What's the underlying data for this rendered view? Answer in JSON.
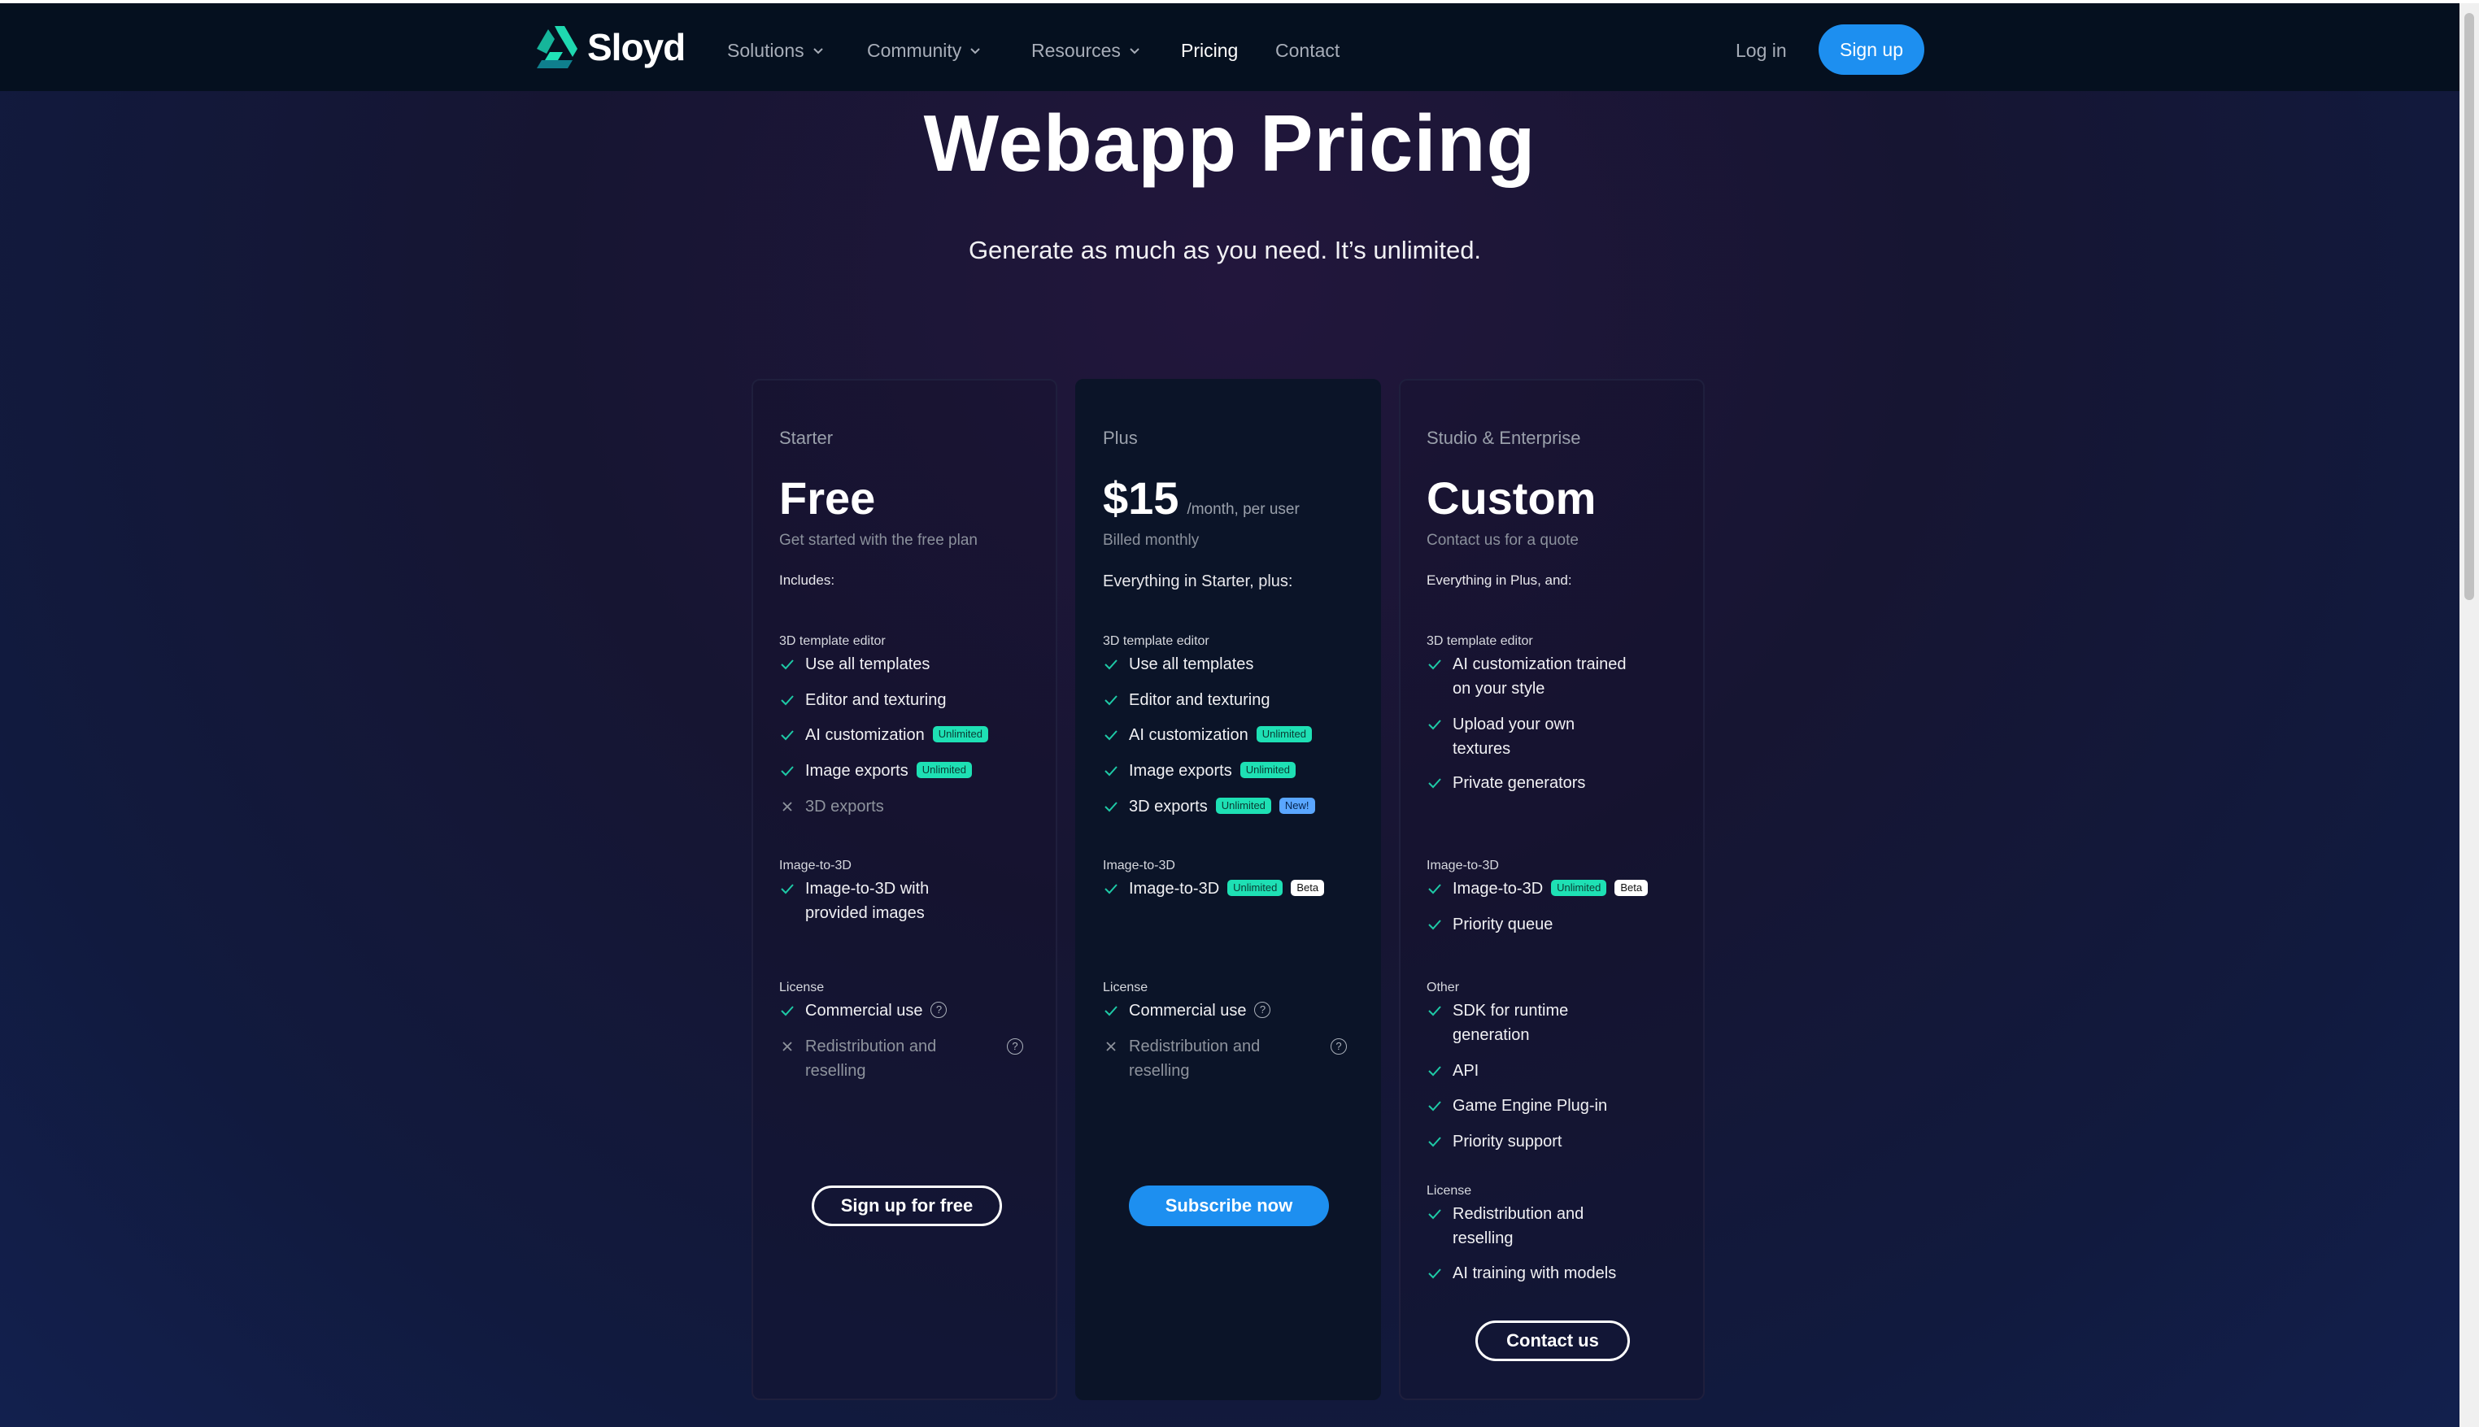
{
  "nav": {
    "logo_text": "Sloyd",
    "items": [
      {
        "label": "Solutions"
      },
      {
        "label": "Community"
      },
      {
        "label": "Resources"
      },
      {
        "label": "Pricing"
      },
      {
        "label": "Contact"
      }
    ],
    "login": "Log in",
    "signup": "Sign up"
  },
  "hero": {
    "title": "Webapp Pricing",
    "subtitle": "Generate as much as you need. It’s unlimited."
  },
  "badges": {
    "unlimited": "Unlimited",
    "new": "New!",
    "beta": "Beta",
    "help": "?"
  },
  "plans": [
    {
      "tier": "Starter",
      "price": "Free",
      "price_note": "Get started with the free plan",
      "includes": "Includes:",
      "editor_label": "3D template editor",
      "editor_features": [
        "Use all templates",
        "Editor and texturing",
        "AI customization",
        "Image exports",
        "3D exports"
      ],
      "i2d_label": "Image-to-3D",
      "i2d_features": [
        "Image-to-3D with provided images"
      ],
      "license_label": "License",
      "license_features": [
        "Commercial use",
        "Redistribution and reselling"
      ],
      "cta": "Sign up for free"
    },
    {
      "tier": "Plus",
      "price": "$15",
      "price_suffix": "/month, per user",
      "price_note": "Billed monthly",
      "includes": "Everything in Starter, plus:",
      "editor_label": "3D template editor",
      "editor_features": [
        "Use all templates",
        "Editor and texturing",
        "AI customization",
        "Image exports",
        "3D exports"
      ],
      "i2d_label": "Image-to-3D",
      "i2d_features": [
        "Image-to-3D"
      ],
      "license_label": "License",
      "license_features": [
        "Commercial use",
        "Redistribution and reselling"
      ],
      "cta": "Subscribe now"
    },
    {
      "tier": "Studio & Enterprise",
      "price": "Custom",
      "price_note": "Contact us for a quote",
      "includes": "Everything in Plus, and:",
      "editor_label": "3D template editor",
      "editor_features": [
        "AI customization trained on your style",
        "Upload your own textures",
        "Private generators"
      ],
      "i2d_label": "Image-to-3D",
      "i2d_features": [
        "Image-to-3D",
        "Priority queue"
      ],
      "other_label": "Other",
      "other_features": [
        "SDK for runtime generation",
        "API",
        "Game Engine Plug-in",
        "Priority support"
      ],
      "license_label": "License",
      "license_features": [
        "Redistribution and reselling",
        "AI training with models"
      ],
      "cta": "Contact us"
    }
  ],
  "colors": {
    "accent": "#1d8ff0",
    "check": "#1ec9a6",
    "badge_unlimited": "#1ee0b4",
    "badge_new": "#5aa6ff",
    "nav_bg": "#05101f"
  },
  "icons": {
    "check": "check-icon",
    "cross": "cross-icon",
    "help": "help-circle-icon",
    "chevron": "chevron-down-icon"
  }
}
